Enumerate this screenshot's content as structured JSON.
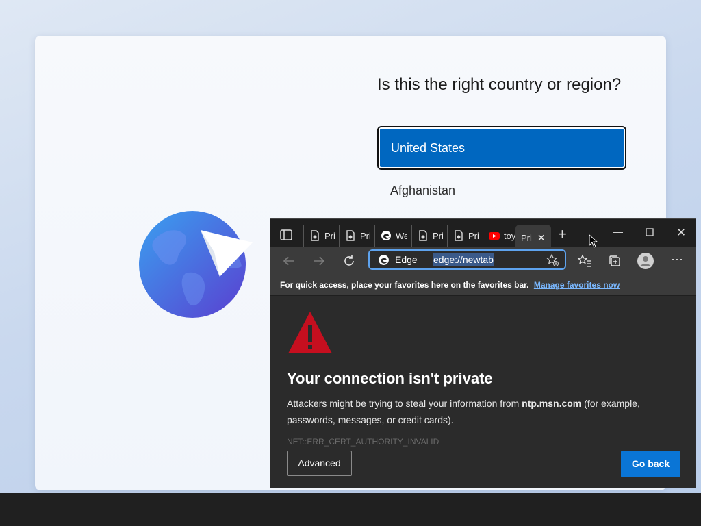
{
  "oobe": {
    "question": "Is this the right country or region?",
    "selected_country": "United States",
    "next_country": "Afghanistan"
  },
  "edge": {
    "tabs": [
      {
        "label": "Pri",
        "icon": "pdf-file-icon"
      },
      {
        "label": "Pri",
        "icon": "pdf-file-icon"
      },
      {
        "label": "We",
        "icon": "edge-icon"
      },
      {
        "label": "Pri",
        "icon": "pdf-file-icon"
      },
      {
        "label": "Pri",
        "icon": "pdf-file-icon"
      },
      {
        "label": "toy",
        "icon": "youtube-icon"
      },
      {
        "label": "Pri",
        "icon": "none",
        "active": true
      }
    ],
    "address": {
      "site_label": "Edge",
      "url": "edge://newtab"
    },
    "favbar": {
      "message": "For quick access, place your favorites here on the favorites bar.",
      "link": "Manage favorites now"
    },
    "error": {
      "title": "Your connection isn't private",
      "body_prefix": "Attackers might be trying to steal your information from ",
      "domain": "ntp.msn.com",
      "body_suffix": " (for example, passwords, messages, or credit cards).",
      "code": "NET::ERR_CERT_AUTHORITY_INVALID",
      "advanced_label": "Advanced",
      "go_back_label": "Go back"
    },
    "colors": {
      "accent": "#0a75d6",
      "warning": "#c50f1f",
      "selection": "#0067c0"
    }
  }
}
